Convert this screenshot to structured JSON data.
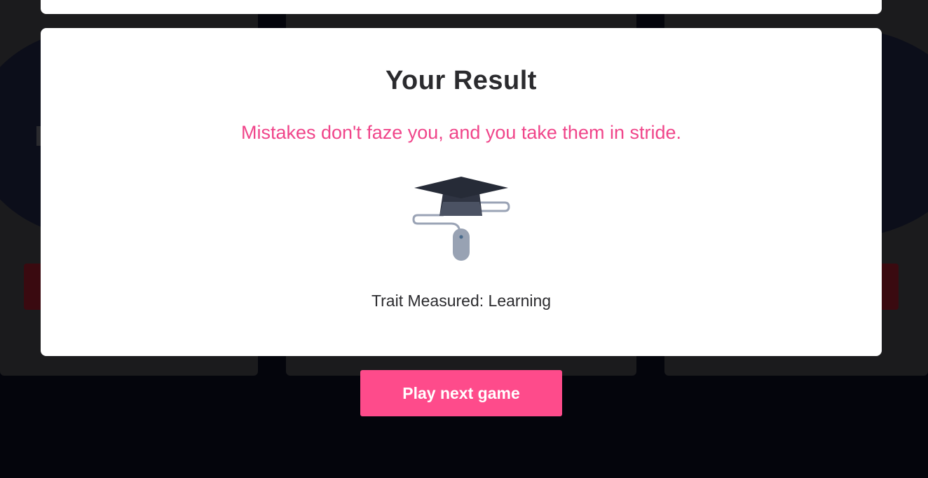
{
  "result": {
    "title": "Your Result",
    "message": "Mistakes don't faze you, and you take them in stride.",
    "icon": "graduation-cap-mouse-icon",
    "trait": "Trait Measured: Learning"
  },
  "actions": {
    "next_label": "Play next game"
  },
  "colors": {
    "accent": "#fe4b8b",
    "message": "#f0458a",
    "background": "#04050c",
    "card": "#ffffff"
  }
}
